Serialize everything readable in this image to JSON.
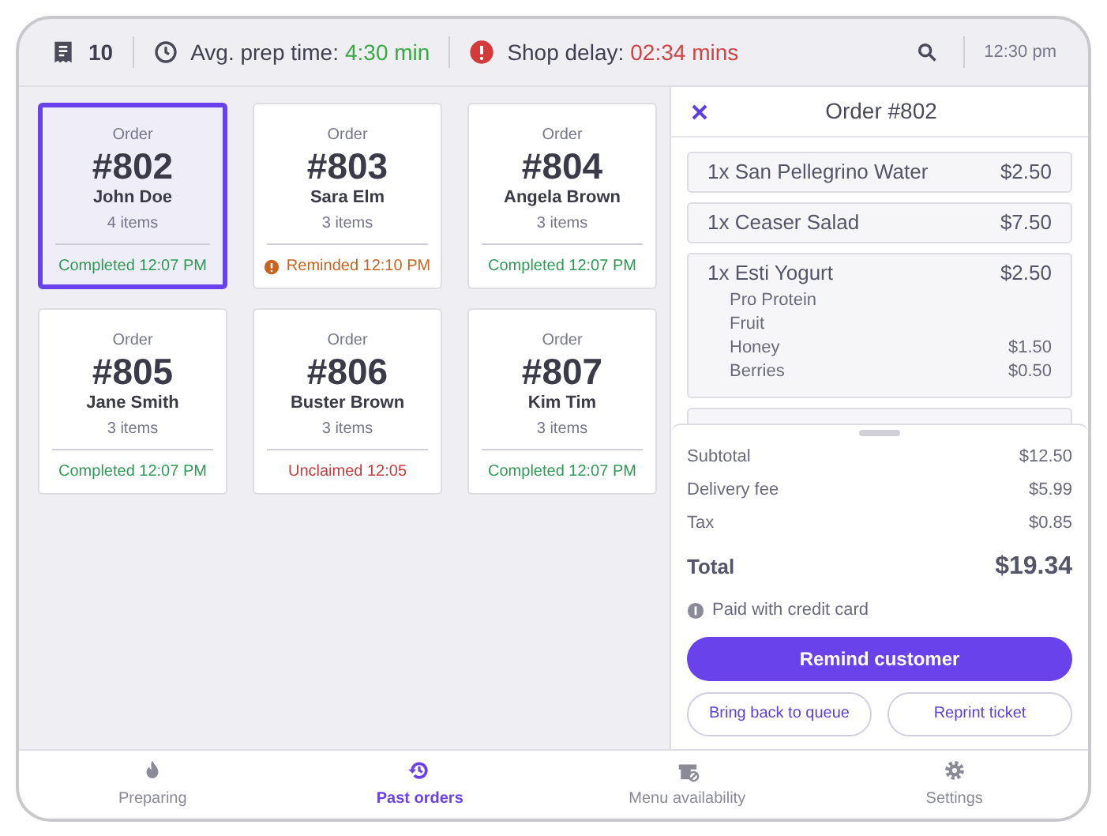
{
  "top_bar": {
    "ticket_count": "10",
    "prep_label": "Avg. prep time:",
    "prep_value": "4:30 min",
    "delay_label": "Shop delay:",
    "delay_value": "02:34 mins",
    "time": "12:30 pm"
  },
  "orders": [
    {
      "label": "Order",
      "number": "#802",
      "customer": "John Doe",
      "items": "4 items",
      "status": "Completed 12:07 PM",
      "kind": "completed",
      "selected": true
    },
    {
      "label": "Order",
      "number": "#803",
      "customer": "Sara Elm",
      "items": "3 items",
      "status": "Reminded 12:10 PM",
      "kind": "reminded",
      "selected": false
    },
    {
      "label": "Order",
      "number": "#804",
      "customer": "Angela Brown",
      "items": "3 items",
      "status": "Completed 12:07 PM",
      "kind": "completed",
      "selected": false
    },
    {
      "label": "Order",
      "number": "#805",
      "customer": "Jane Smith",
      "items": "3 items",
      "status": "Completed 12:07 PM",
      "kind": "completed",
      "selected": false
    },
    {
      "label": "Order",
      "number": "#806",
      "customer": "Buster Brown",
      "items": "3 items",
      "status": "Unclaimed 12:05",
      "kind": "unclaimed",
      "selected": false
    },
    {
      "label": "Order",
      "number": "#807",
      "customer": "Kim Tim",
      "items": "3 items",
      "status": "Completed 12:07 PM",
      "kind": "completed",
      "selected": false
    }
  ],
  "detail": {
    "title": "Order #802",
    "items": [
      {
        "name": "1x San Pellegrino Water",
        "price": "$2.50"
      },
      {
        "name": "1x Ceaser Salad",
        "price": "$7.50"
      },
      {
        "name": "1x Esti Yogurt",
        "price": "$2.50",
        "options": [
          {
            "name": "Pro Protein"
          },
          {
            "name": "Fruit"
          },
          {
            "name": "Honey",
            "price": "$1.50"
          },
          {
            "name": "Berries",
            "price": "$0.50"
          }
        ]
      }
    ],
    "summary": [
      {
        "label": "Subtotal",
        "value": "$12.50"
      },
      {
        "label": "Delivery fee",
        "value": "$5.99"
      },
      {
        "label": "Tax",
        "value": "$0.85"
      }
    ],
    "total_label": "Total",
    "total_value": "$19.34",
    "payment": "Paid with credit card",
    "primary_button": "Remind customer",
    "buttons": [
      "Bring back to queue",
      "Reprint ticket"
    ]
  },
  "nav": [
    {
      "label": "Preparing",
      "kind": "preparing",
      "selected": false
    },
    {
      "label": "Past orders",
      "kind": "past",
      "selected": true
    },
    {
      "label": "Menu availability",
      "kind": "menu",
      "selected": false
    },
    {
      "label": "Settings",
      "kind": "settings",
      "selected": false
    }
  ]
}
